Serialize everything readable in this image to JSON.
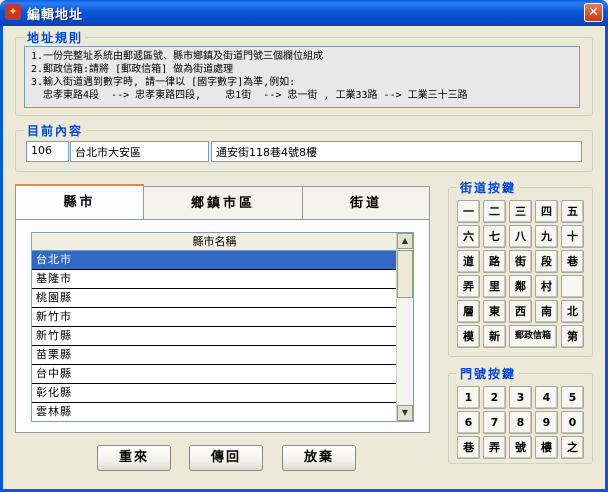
{
  "window": {
    "title": "編輯地址",
    "close": "✕"
  },
  "rules": {
    "legend": "地址規則",
    "lines": [
      "1.一份完整址系統由郵遞區號、縣市鄉鎮及街道門號三個欄位組成",
      "2.郵政信箱:請將 [郵政信箱] 做為街道處理",
      "3.輸入街道遇到數字時, 請一律以 [國字數字]為準,例如:",
      "  忠孝東路4段  --> 忠孝東路四段,    忠1街  --> 忠一街 , 工業33路 --> 工業三十三路"
    ]
  },
  "current": {
    "legend": "目前內容",
    "zip": "106",
    "city_district": "台北市大安區",
    "street": "通安街118巷4號8樓"
  },
  "tabs": [
    {
      "label": "縣市",
      "active": true
    },
    {
      "label": "鄉鎮市區",
      "active": false
    },
    {
      "label": "街道",
      "active": false
    }
  ],
  "city_list": {
    "header": "縣市名稱",
    "items": [
      "台北市",
      "基隆市",
      "桃園縣",
      "新竹市",
      "新竹縣",
      "苗栗縣",
      "台中縣",
      "彰化縣",
      "雲林縣"
    ],
    "selected_index": 0
  },
  "street_keys": {
    "legend": "街道按鍵",
    "rows": [
      [
        "一",
        "二",
        "三",
        "四",
        "五"
      ],
      [
        "六",
        "七",
        "八",
        "九",
        "十"
      ],
      [
        "道",
        "路",
        "街",
        "段",
        "巷"
      ],
      [
        "弄",
        "里",
        "鄰",
        "村",
        ""
      ],
      [
        "層",
        "東",
        "西",
        "南",
        "北"
      ],
      [
        "模",
        "新",
        "郵政信箱",
        "第"
      ]
    ]
  },
  "number_keys": {
    "legend": "門號按鍵",
    "rows": [
      [
        "1",
        "2",
        "3",
        "4",
        "5"
      ],
      [
        "6",
        "7",
        "8",
        "9",
        "0"
      ],
      [
        "巷",
        "弄",
        "號",
        "樓",
        "之"
      ]
    ]
  },
  "buttons": {
    "reset": "重來",
    "return": "傳回",
    "discard": "放棄"
  }
}
